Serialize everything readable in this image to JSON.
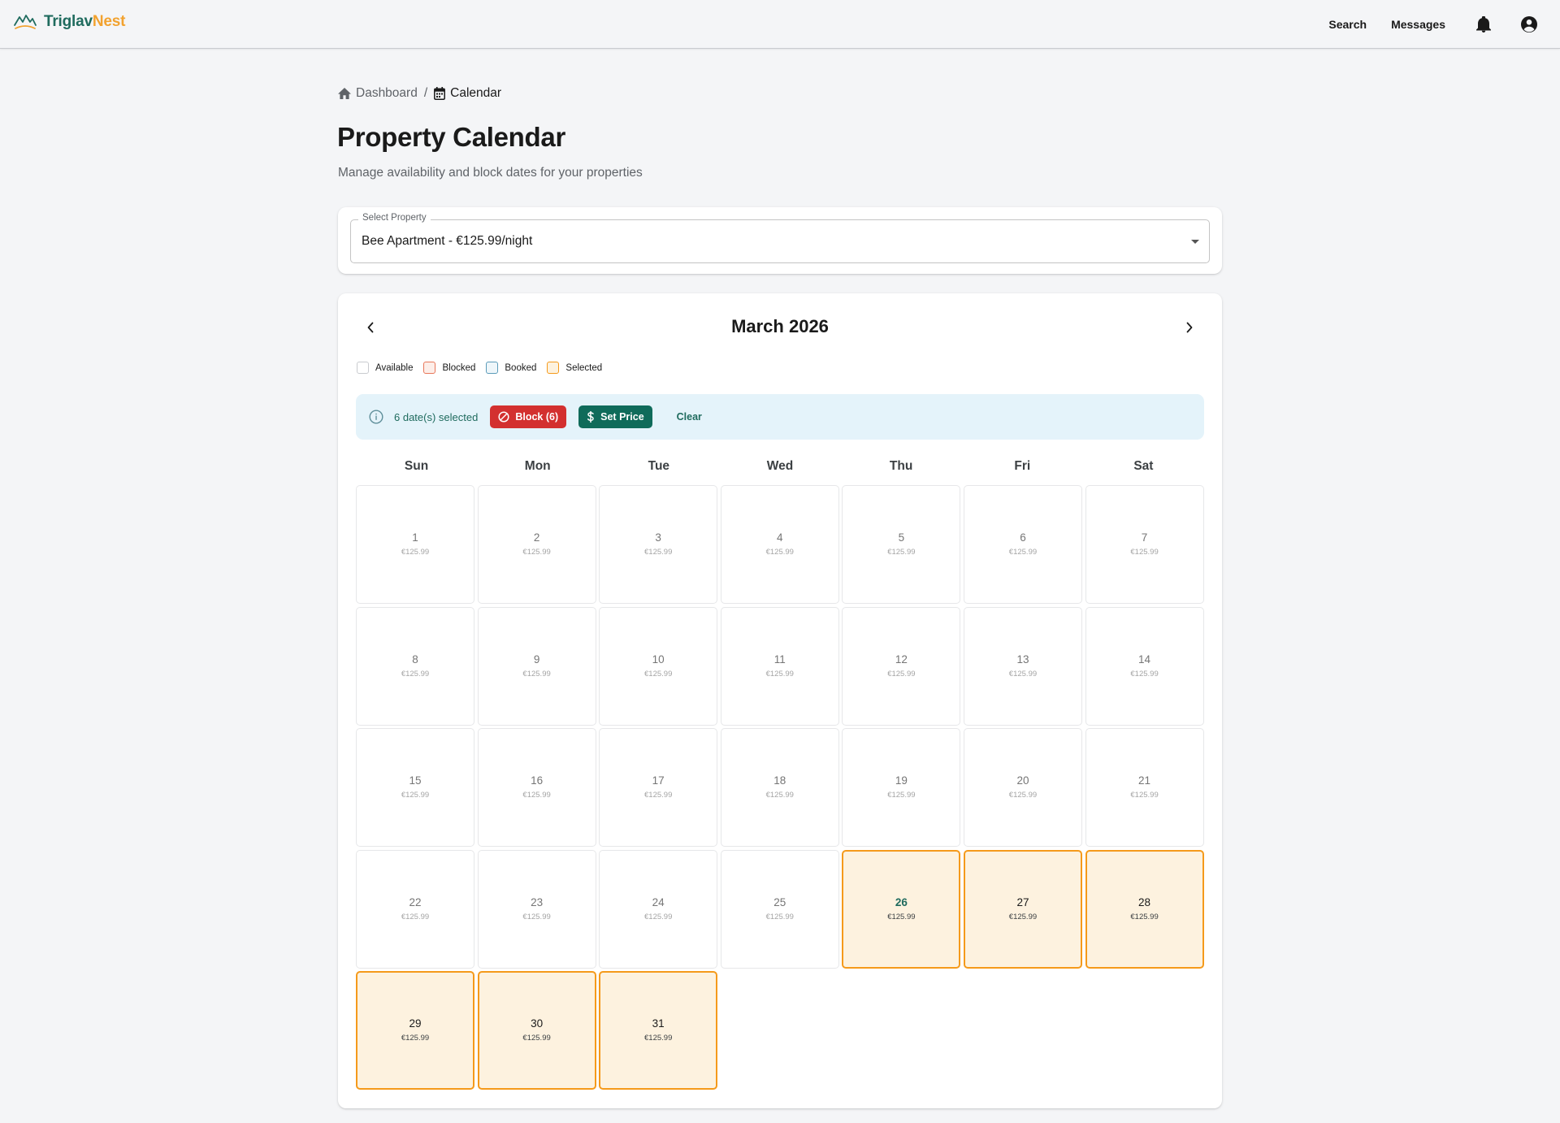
{
  "app": {
    "logo_part1": "Triglav",
    "logo_part2": "Nest",
    "brand_color": "#1f6b5e",
    "accent_color": "#f2a22f"
  },
  "nav": {
    "search": "Search",
    "messages": "Messages",
    "notifications_icon": "bell-icon",
    "account_icon": "account-circle-icon"
  },
  "breadcrumb": {
    "home_label": "Dashboard",
    "separator": "/",
    "current_label": "Calendar"
  },
  "page": {
    "title": "Property Calendar",
    "subtitle": "Manage availability and block dates for your properties"
  },
  "property_select": {
    "label": "Select Property",
    "value": "Bee Apartment - €125.99/night"
  },
  "calendar": {
    "month_label": "March 2026",
    "legend": [
      {
        "label": "Available",
        "color": "#c9cbcf"
      },
      {
        "label": "Blocked",
        "color": "#e8775a"
      },
      {
        "label": "Booked",
        "color": "#5b9bb9"
      },
      {
        "label": "Selected",
        "color": "#f59a1b"
      }
    ],
    "selection": {
      "text": "6 date(s) selected",
      "block_label": "Block (6)",
      "set_price_label": "Set Price",
      "clear_label": "Clear",
      "block_color": "#d3302f",
      "set_price_color": "#0f6b5a"
    },
    "weekdays": [
      "Sun",
      "Mon",
      "Tue",
      "Wed",
      "Thu",
      "Fri",
      "Sat"
    ],
    "days": [
      {
        "day": "1",
        "price": "€125.99",
        "state": "available"
      },
      {
        "day": "2",
        "price": "€125.99",
        "state": "available"
      },
      {
        "day": "3",
        "price": "€125.99",
        "state": "available"
      },
      {
        "day": "4",
        "price": "€125.99",
        "state": "available"
      },
      {
        "day": "5",
        "price": "€125.99",
        "state": "available"
      },
      {
        "day": "6",
        "price": "€125.99",
        "state": "available"
      },
      {
        "day": "7",
        "price": "€125.99",
        "state": "available"
      },
      {
        "day": "8",
        "price": "€125.99",
        "state": "available"
      },
      {
        "day": "9",
        "price": "€125.99",
        "state": "available"
      },
      {
        "day": "10",
        "price": "€125.99",
        "state": "available"
      },
      {
        "day": "11",
        "price": "€125.99",
        "state": "available"
      },
      {
        "day": "12",
        "price": "€125.99",
        "state": "available"
      },
      {
        "day": "13",
        "price": "€125.99",
        "state": "available"
      },
      {
        "day": "14",
        "price": "€125.99",
        "state": "available"
      },
      {
        "day": "15",
        "price": "€125.99",
        "state": "available"
      },
      {
        "day": "16",
        "price": "€125.99",
        "state": "available"
      },
      {
        "day": "17",
        "price": "€125.99",
        "state": "available"
      },
      {
        "day": "18",
        "price": "€125.99",
        "state": "available"
      },
      {
        "day": "19",
        "price": "€125.99",
        "state": "available"
      },
      {
        "day": "20",
        "price": "€125.99",
        "state": "available"
      },
      {
        "day": "21",
        "price": "€125.99",
        "state": "available"
      },
      {
        "day": "22",
        "price": "€125.99",
        "state": "available"
      },
      {
        "day": "23",
        "price": "€125.99",
        "state": "available"
      },
      {
        "day": "24",
        "price": "€125.99",
        "state": "available"
      },
      {
        "day": "25",
        "price": "€125.99",
        "state": "available"
      },
      {
        "day": "26",
        "price": "€125.99",
        "state": "selected",
        "today": true
      },
      {
        "day": "27",
        "price": "€125.99",
        "state": "selected"
      },
      {
        "day": "28",
        "price": "€125.99",
        "state": "selected"
      },
      {
        "day": "29",
        "price": "€125.99",
        "state": "selected"
      },
      {
        "day": "30",
        "price": "€125.99",
        "state": "selected"
      },
      {
        "day": "31",
        "price": "€125.99",
        "state": "selected"
      }
    ]
  }
}
